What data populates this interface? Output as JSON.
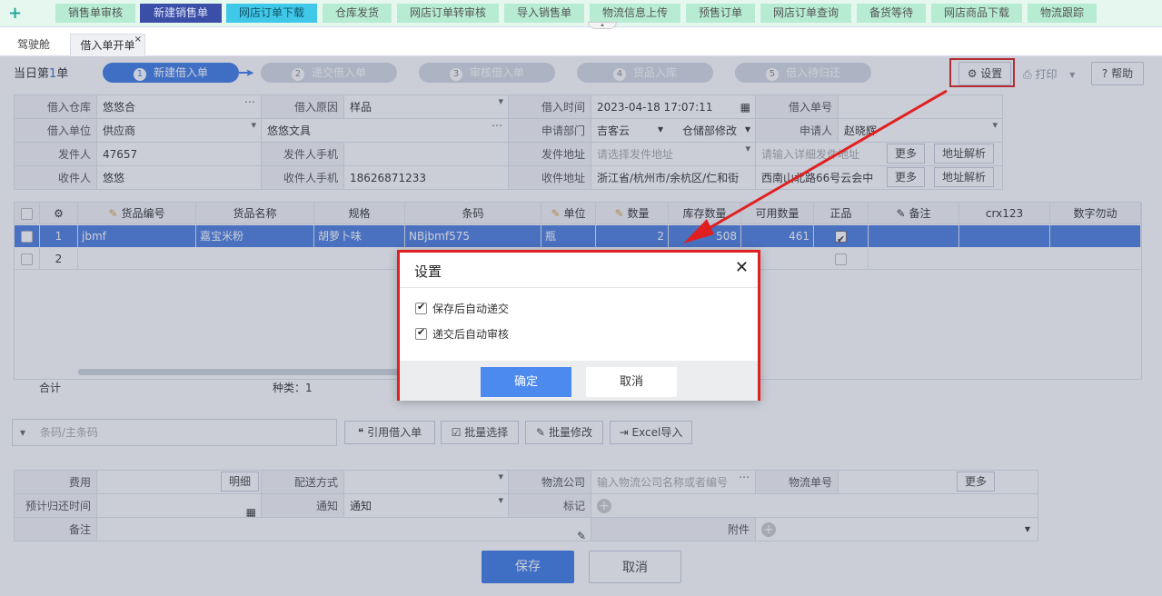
{
  "topnav": {
    "tabs": [
      "销售单审核",
      "新建销售单",
      "网店订单下载",
      "仓库发货",
      "网店订单转审核",
      "导入销售单",
      "物流信息上传",
      "预售订单",
      "网店订单查询",
      "备货等待",
      "网店商品下载",
      "物流跟踪"
    ]
  },
  "pagetabs": {
    "cockpit": "驾驶舱",
    "current": "借入单开单",
    "close": "×"
  },
  "today": {
    "prefix": "当日第",
    "count": "1",
    "suffix": "单"
  },
  "steps": [
    "新建借入单",
    "递交借入单",
    "审核借入单",
    "货品入库",
    "借入待归还"
  ],
  "step_numbers": [
    "1",
    "2",
    "3",
    "4",
    "5"
  ],
  "toolbar": {
    "settings": "设置",
    "print": "打印",
    "help": "帮助"
  },
  "form": {
    "warehouse_label": "借入仓库",
    "warehouse": "悠悠合",
    "reason_label": "借入原因",
    "reason": "样品",
    "time_label": "借入时间",
    "time": "2023-04-18 17:07:11",
    "no_label": "借入单号",
    "no": "",
    "unit_label": "借入单位",
    "unit_type": "供应商",
    "unit": "悠悠文具",
    "dept_label": "申请部门",
    "dept": "吉客云",
    "dept2": "仓储部修改",
    "applicant_label": "申请人",
    "applicant": "赵晓辉",
    "sender_label": "发件人",
    "sender": "47657",
    "sender_phone_label": "发件人手机",
    "sender_phone": "",
    "sender_addr_label": "发件地址",
    "sender_addr_ph": "请选择发件地址",
    "sender_addr_detail_ph": "请输入详细发件地址",
    "receiver_label": "收件人",
    "receiver": "悠悠",
    "receiver_phone_label": "收件人手机",
    "receiver_phone": "18626871233",
    "receiver_addr_label": "收件地址",
    "receiver_addr": "浙江省/杭州市/余杭区/仁和街",
    "receiver_addr_detail": "西南山北路66号云会中",
    "more": "更多",
    "parse": "地址解析"
  },
  "grid": {
    "headers": [
      "货品编号",
      "货品名称",
      "规格",
      "条码",
      "单位",
      "数量",
      "库存数量",
      "可用数量",
      "正品",
      "备注",
      "crx123",
      "数字勿动"
    ],
    "rows": [
      {
        "idx": "1",
        "code": "jbmf",
        "name": "嘉宝米粉",
        "spec": "胡萝卜味",
        "barcode": "NBjbmf575",
        "unit": "瓶",
        "qty": "2",
        "stock": "508",
        "avail": "461"
      },
      {
        "idx": "2"
      }
    ],
    "sum_label": "合计",
    "kinds": "种类：1"
  },
  "search": {
    "placeholder": "条码/主条码"
  },
  "actions": {
    "ref": "引用借入单",
    "batch_select": "批量选择",
    "batch_edit": "批量修改",
    "excel": "Excel导入"
  },
  "bottom": {
    "fee_label": "费用",
    "detail": "明细",
    "ship_label": "配送方式",
    "logistics_label": "物流公司",
    "logistics_ph": "输入物流公司名称或者编号",
    "track_label": "物流单号",
    "more": "更多",
    "return_label": "预计归还时间",
    "notify_label": "通知",
    "notify": "通知",
    "mark_label": "标记",
    "remark_label": "备注",
    "attach_label": "附件"
  },
  "footer": {
    "save": "保存",
    "cancel": "取消"
  },
  "dialog": {
    "title": "设置",
    "opt1": "保存后自动递交",
    "opt2": "递交后自动审核",
    "ok": "确定",
    "cancel": "取消"
  }
}
